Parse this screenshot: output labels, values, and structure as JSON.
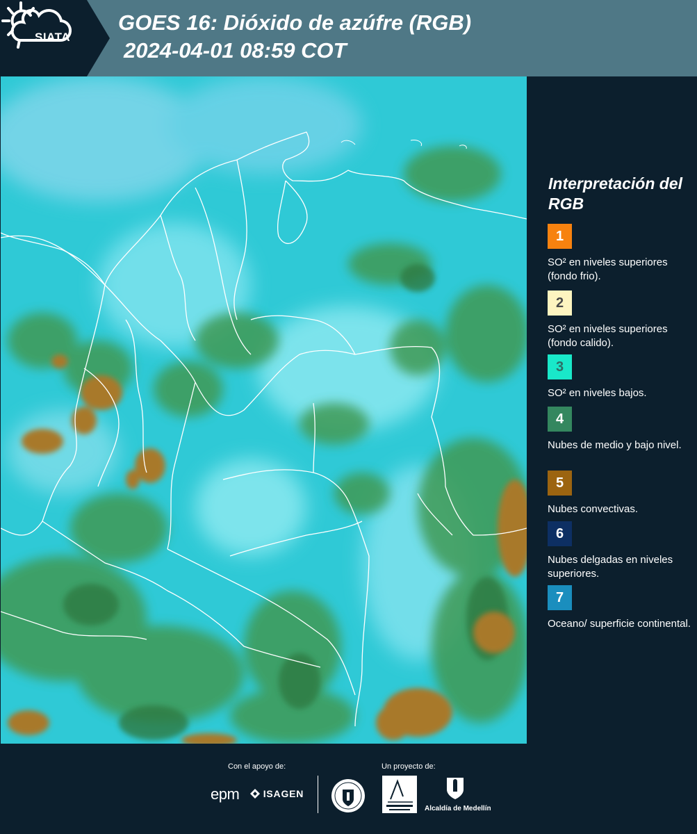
{
  "header": {
    "logo_text": "SIATA",
    "title": "GOES 16: Dióxido de azúfre (RGB)",
    "subtitle": "2024-04-01 08:59 COT",
    "bg_color": "#4f7886"
  },
  "legend": {
    "title": "Interpretación del RGB",
    "items": [
      {
        "num": "1",
        "color": "#f7820f",
        "text": "SO² en niveles superiores (fondo frio)."
      },
      {
        "num": "2",
        "color": "#fdf4c0",
        "text": "SO² en niveles superiores (fondo calido)."
      },
      {
        "num": "3",
        "color": "#19e8c9",
        "text": "SO² en niveles bajos."
      },
      {
        "num": "4",
        "color": "#34875f",
        "text": "Nubes de medio y bajo nivel."
      },
      {
        "num": "5",
        "color": "#9c6410",
        "text": "Nubes convectivas."
      },
      {
        "num": "6",
        "color": "#0d2f63",
        "text": "Nubes delgadas en niveles superiores."
      },
      {
        "num": "7",
        "color": "#1a8ebe",
        "text": "Oceano/ superficie continental."
      }
    ]
  },
  "footer": {
    "support_label": "Con el apoyo de:",
    "project_label": "Un proyecto de:",
    "logos": {
      "epm": "epm",
      "isagen": "ISAGEN",
      "area": "Área Metropolitana Valle de Aburrá",
      "alcaldia": "Alcaldía de Medellín"
    }
  },
  "map": {
    "description_colors": {
      "base": "#2fc9d6",
      "low_cloud": "#3f9a55",
      "convective": "#a8792c",
      "high_cloud": "#8ae4ef"
    }
  }
}
